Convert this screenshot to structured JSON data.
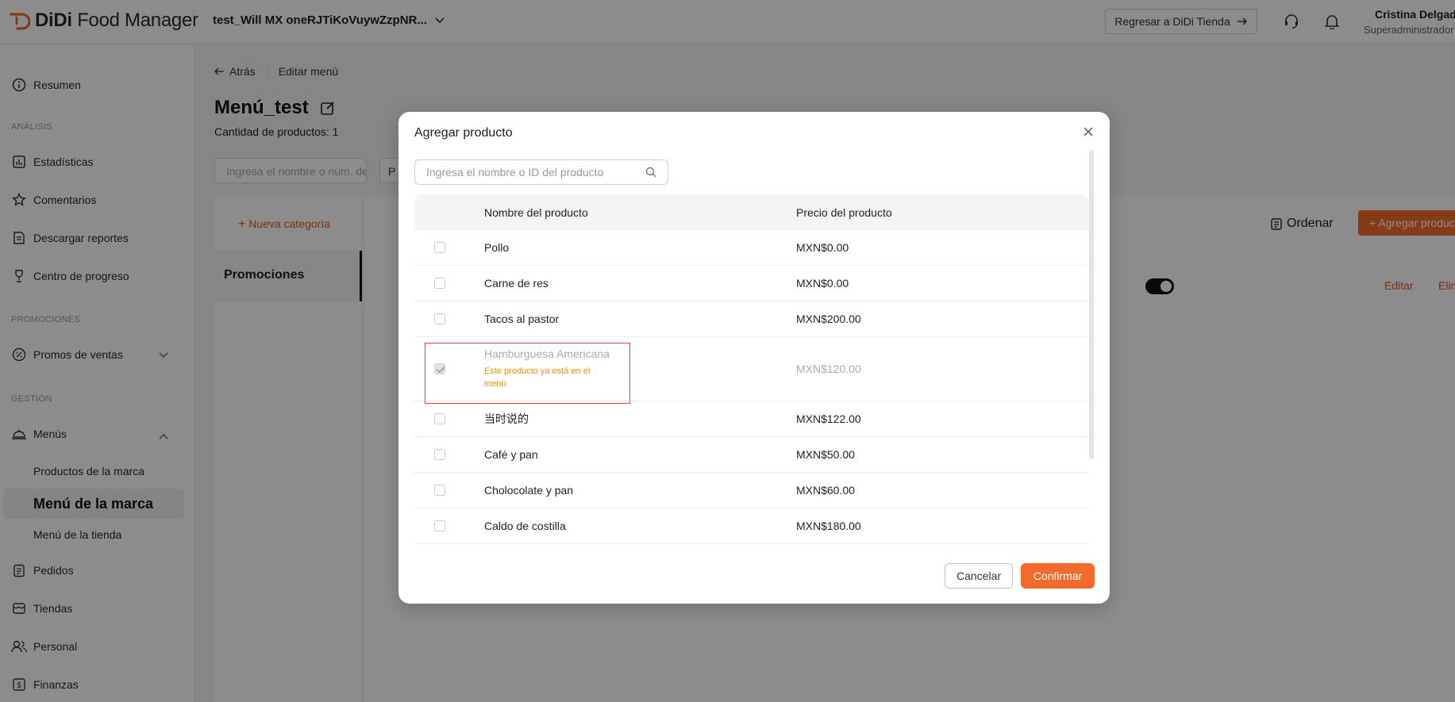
{
  "app": {
    "logo_brand": "DiDi",
    "logo_product": "Food Manager",
    "store_name": "test_Will MX oneRJTiKoVuywZzpNR...",
    "back_button": "Regresar a DiDi Tienda",
    "user_name": "Cristina Delgado",
    "user_role": "Superadministrador",
    "accent_color": "#f36a2c"
  },
  "sidebar": {
    "resumen": "Resumen",
    "section_analisis": "ANÁLISIS",
    "estadisticas": "Estadísticas",
    "comentarios": "Comentarios",
    "descargar": "Descargar reportes",
    "progreso": "Centro de progreso",
    "section_promociones": "PROMOCIONES",
    "promos": "Promos de ventas",
    "section_gestion": "GESTIÓN",
    "menus": "Menús",
    "productos_marca": "Productos de la marca",
    "menu_marca": "Menú de la marca",
    "menu_tienda": "Menú de la tienda",
    "pedidos": "Pedidos",
    "tiendas": "Tiendas",
    "personal": "Personal",
    "finanzas": "Finanzas"
  },
  "main": {
    "back": "Atrás",
    "breadcrumb": "Editar menú",
    "title": "Menú_test",
    "product_count": "Cantidad de productos: 1",
    "search_placeholder": "Ingresa el nombre o núm. de",
    "filter_label": "P",
    "new_category": "Nueva categoría",
    "category": "Promociones",
    "sort": "Ordenar",
    "add_product": "Agregar producto",
    "edit": "Editar",
    "delete": "Elimi"
  },
  "modal": {
    "title": "Agregar producto",
    "search_placeholder": "Ingresa el nombre o ID del producto",
    "col_name": "Nombre del producto",
    "col_price": "Precio del producto",
    "rows": [
      {
        "name": "Pollo",
        "price": "MXN$0.00"
      },
      {
        "name": "Carne de res",
        "price": "MXN$0.00"
      },
      {
        "name": "Tacos al pastor",
        "price": "MXN$200.00"
      },
      {
        "name": "Hamburguesa Americana",
        "price": "MXN$120.00",
        "note": "Este producto ya está en el menú"
      },
      {
        "name": "当时说的",
        "price": "MXN$122.00"
      },
      {
        "name": "Café y pan",
        "price": "MXN$50.00"
      },
      {
        "name": "Cholocolate y pan",
        "price": "MXN$60.00"
      },
      {
        "name": "Caldo de costilla",
        "price": "MXN$180.00"
      }
    ],
    "cancel": "Cancelar",
    "confirm": "Confirmar"
  }
}
